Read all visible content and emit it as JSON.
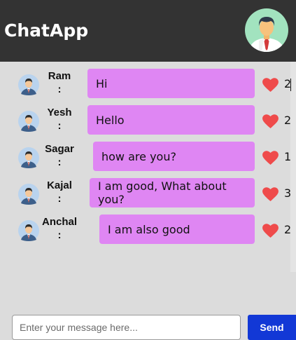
{
  "app": {
    "title": "ChatApp"
  },
  "colors": {
    "header_bg": "#333333",
    "page_bg": "#dcdcdc",
    "bubble_bg": "#df86f3",
    "heart": "#ef4b4b",
    "send_button": "#1238d6"
  },
  "messages": [
    {
      "sender": "Ram",
      "colon": ":",
      "text": "Hi",
      "likes": "2"
    },
    {
      "sender": "Yesh",
      "colon": ":",
      "text": "Hello",
      "likes": "2"
    },
    {
      "sender": "Sagar",
      "colon": ":",
      "text": "how are you?",
      "likes": "1"
    },
    {
      "sender": "Kajal",
      "colon": ":",
      "text": "I am good, What about you?",
      "likes": "3"
    },
    {
      "sender": "Anchal",
      "colon": ":",
      "text": "I am also good",
      "likes": "2"
    }
  ],
  "composer": {
    "placeholder": "Enter your message here...",
    "value": "",
    "send_label": "Send"
  },
  "icons": {
    "profile": "user-avatar-icon",
    "message_avatar": "user-avatar-icon",
    "like": "heart-icon"
  }
}
